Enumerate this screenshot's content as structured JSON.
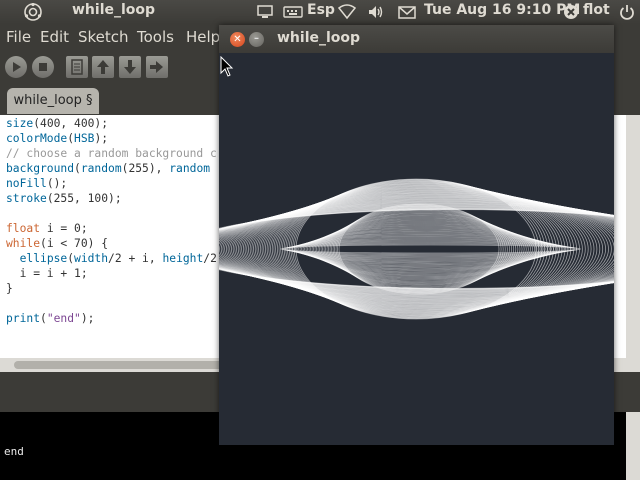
{
  "top_panel": {
    "app_title": "while_loop",
    "keyboard_layout": "Esp",
    "datetime": "Tue Aug 16  9:10 PM",
    "user": "flot",
    "icons": [
      "ubuntu-logo-icon",
      "monitor-icon",
      "keyboard-icon",
      "wifi-icon",
      "volume-icon",
      "mail-icon",
      "close-icon",
      "power-icon"
    ]
  },
  "menu": {
    "file": "File",
    "edit": "Edit",
    "sketch": "Sketch",
    "tools": "Tools",
    "help": "Help"
  },
  "toolbar": {
    "buttons": [
      "run",
      "stop",
      "new",
      "open",
      "save",
      "export"
    ]
  },
  "tab": {
    "label": "while_loop §"
  },
  "code_lines": [
    "size(400, 400);",
    "colorMode(HSB);",
    "// choose a random background c",
    "background(random(255), random",
    "noFill();",
    "stroke(255, 100);",
    "",
    "float i = 0;",
    "while(i < 70) {",
    "  ellipse(width/2 + i, height/2",
    "  i = i + 1;",
    "}",
    "",
    "print(\"end\");"
  ],
  "console": {
    "output": "end"
  },
  "sketch_window": {
    "title": "while_loop",
    "background": "#262b34",
    "stroke": "#ffffff"
  }
}
